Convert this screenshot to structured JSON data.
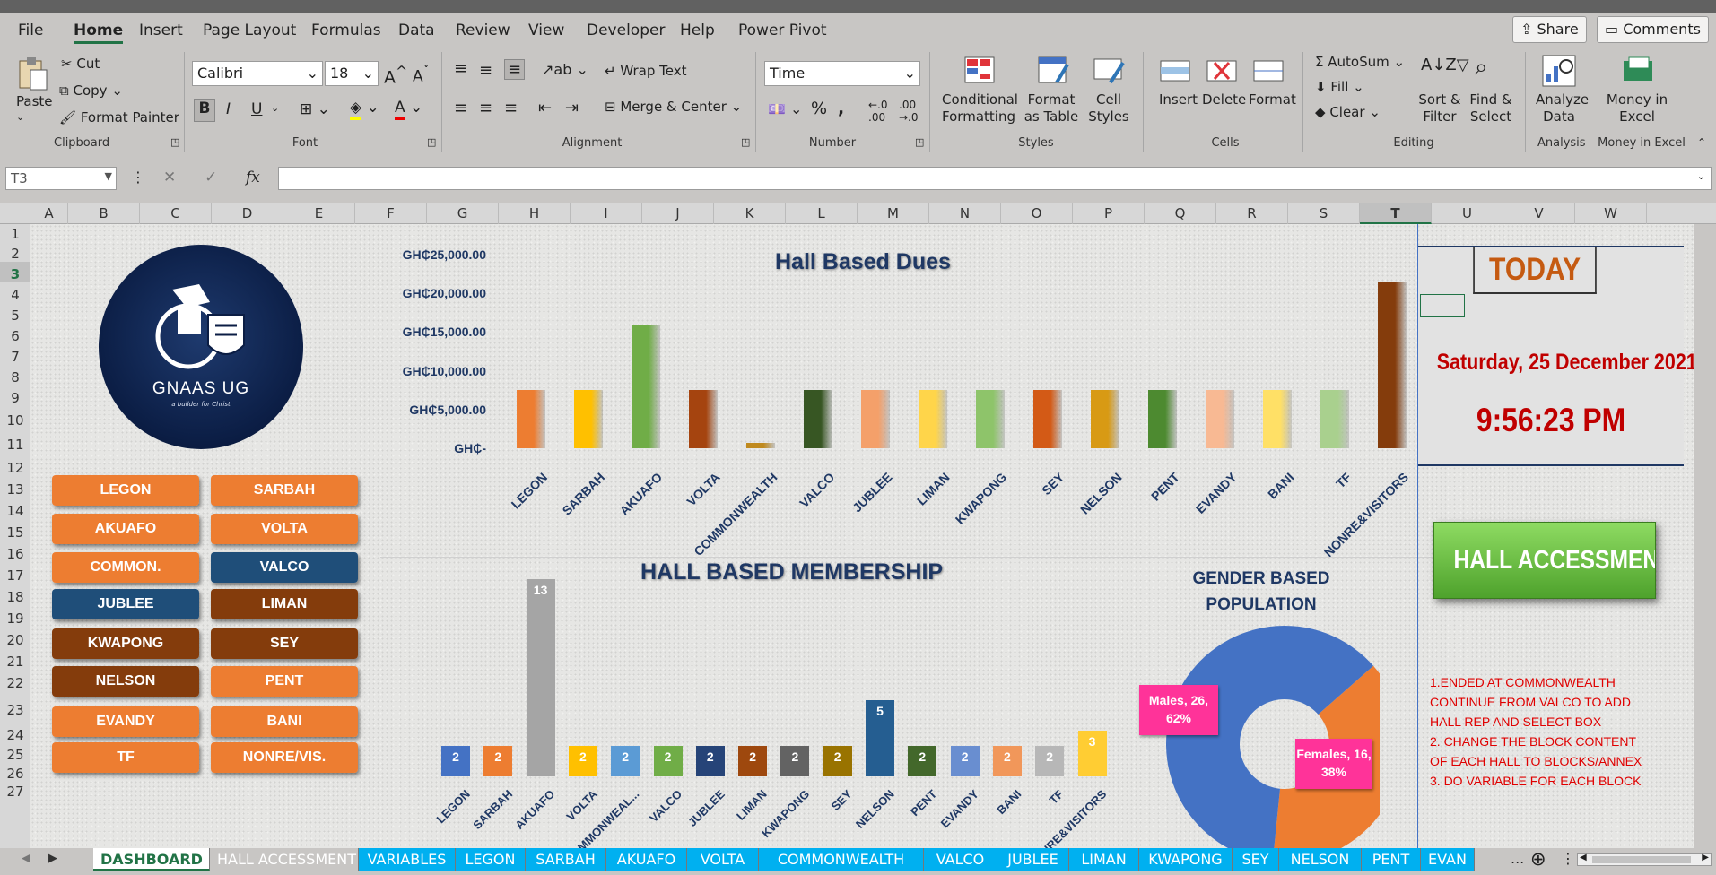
{
  "menu": {
    "items": [
      "File",
      "Home",
      "Insert",
      "Page Layout",
      "Formulas",
      "Data",
      "Review",
      "View",
      "Developer",
      "Help",
      "Power Pivot"
    ],
    "active": "Home",
    "share_label": "Share",
    "comments_label": "Comments"
  },
  "ribbon": {
    "clipboard": {
      "paste": "Paste",
      "cut": "Cut",
      "copy": "Copy",
      "format_painter": "Format Painter",
      "group": "Clipboard"
    },
    "font": {
      "name": "Calibri",
      "size": "18",
      "bold": "B",
      "italic": "I",
      "underline": "U",
      "group": "Font"
    },
    "alignment": {
      "wrap": "Wrap Text",
      "merge": "Merge & Center",
      "group": "Alignment"
    },
    "number": {
      "format": "Time",
      "group": "Number"
    },
    "styles": {
      "conditional": "Conditional Formatting",
      "format_table": "Format as Table",
      "cell_styles": "Cell Styles",
      "group": "Styles"
    },
    "cells": {
      "insert": "Insert",
      "delete": "Delete",
      "format": "Format",
      "group": "Cells"
    },
    "editing": {
      "autosum": "AutoSum",
      "fill": "Fill",
      "clear": "Clear",
      "sort": "Sort & Filter",
      "find": "Find & Select",
      "group": "Editing"
    },
    "analysis": {
      "analyze": "Analyze Data",
      "group": "Analysis"
    },
    "money": {
      "money": "Money in Excel",
      "group": "Money in Excel"
    }
  },
  "formula_bar": {
    "name_box": "T3",
    "fx": "fx",
    "content": ""
  },
  "columns": [
    "A",
    "B",
    "C",
    "D",
    "E",
    "F",
    "G",
    "H",
    "I",
    "J",
    "K",
    "L",
    "M",
    "N",
    "O",
    "P",
    "Q",
    "R",
    "S",
    "T",
    "U",
    "V",
    "W"
  ],
  "rows": [
    "1",
    "2",
    "3",
    "4",
    "5",
    "6",
    "7",
    "8",
    "9",
    "10",
    "11",
    "12",
    "13",
    "14",
    "15",
    "16",
    "17",
    "18",
    "19",
    "20",
    "21",
    "22",
    "23",
    "24",
    "25",
    "26",
    "27"
  ],
  "logo": {
    "text": "GNAAS UG",
    "tagline": "a builder for Christ"
  },
  "hall_buttons": [
    {
      "label": "LEGON",
      "color": "#ed7d31"
    },
    {
      "label": "SARBAH",
      "color": "#ed7d31"
    },
    {
      "label": "AKUAFO",
      "color": "#ed7d31"
    },
    {
      "label": "VOLTA",
      "color": "#ed7d31"
    },
    {
      "label": "COMMON.",
      "color": "#ed7d31"
    },
    {
      "label": "VALCO",
      "color": "#1f4e79"
    },
    {
      "label": "JUBLEE",
      "color": "#1f4e79"
    },
    {
      "label": "LIMAN",
      "color": "#843c0c"
    },
    {
      "label": "KWAPONG",
      "color": "#843c0c"
    },
    {
      "label": "SEY",
      "color": "#843c0c"
    },
    {
      "label": "NELSON",
      "color": "#843c0c"
    },
    {
      "label": "PENT",
      "color": "#ed7d31"
    },
    {
      "label": "EVANDY",
      "color": "#ed7d31"
    },
    {
      "label": "BANI",
      "color": "#ed7d31"
    },
    {
      "label": "TF",
      "color": "#ed7d31"
    },
    {
      "label": "NONRE/VIS.",
      "color": "#ed7d31"
    }
  ],
  "chart_data": [
    {
      "type": "bar",
      "title": "Hall Based Dues",
      "y_ticks": [
        "GH₵25,000.00",
        "GH₵20,000.00",
        "GH₵15,000.00",
        "GH₵10,000.00",
        "GH₵5,000.00",
        "GH₵-"
      ],
      "ylim": [
        0,
        25000
      ],
      "categories": [
        "LEGON",
        "SARBAH",
        "AKUAFO",
        "VOLTA",
        "COMMONWEALTH",
        "VALCO",
        "JUBLEE",
        "LIMAN",
        "KWAPONG",
        "SEY",
        "NELSON",
        "PENT",
        "EVANDY",
        "BANI",
        "TF",
        "NONRE&VISITORS"
      ],
      "values": [
        7500,
        7500,
        16000,
        7500,
        700,
        7500,
        7500,
        7500,
        7500,
        7500,
        7500,
        7500,
        7500,
        7500,
        7500,
        21500
      ],
      "colors": [
        "#ed7d31",
        "#ffc000",
        "#70ad47",
        "#a5440f",
        "#c08a1e",
        "#375623",
        "#f4a06a",
        "#ffd54a",
        "#8ec46a",
        "#d35a16",
        "#d89a14",
        "#4d8a30",
        "#f8b993",
        "#ffe066",
        "#a9d08e",
        "#843c0c"
      ]
    },
    {
      "type": "bar",
      "title": "HALL BASED MEMBERSHIP",
      "categories": [
        "LEGON",
        "SARBAH",
        "AKUAFO",
        "VOLTA",
        "COMMONWEAL...",
        "VALCO",
        "JUBLEE",
        "LIMAN",
        "KWAPONG",
        "SEY",
        "NELSON",
        "PENT",
        "EVANDY",
        "BANI",
        "TF",
        "NONRE&VISITORS"
      ],
      "values": [
        2,
        2,
        13,
        2,
        2,
        2,
        2,
        2,
        2,
        2,
        5,
        2,
        2,
        2,
        2,
        3
      ],
      "labels": [
        "2",
        "2",
        "13",
        "2",
        "2",
        "2",
        "2",
        "2",
        "2",
        "2",
        "5",
        "2",
        "2",
        "2",
        "2",
        "3"
      ],
      "colors": [
        "#4472c4",
        "#ed7d31",
        "#a5a5a5",
        "#ffc000",
        "#5b9bd5",
        "#70ad47",
        "#264478",
        "#9e480e",
        "#636363",
        "#997300",
        "#255e91",
        "#43682b",
        "#698ed0",
        "#f1975a",
        "#b7b7b7",
        "#ffcd33"
      ]
    },
    {
      "type": "pie",
      "title": "GENDER BASED POPULATION",
      "series": [
        {
          "name": "Males",
          "value": 26,
          "percent": 62,
          "label": "Males, 26, 62%",
          "color": "#4472c4"
        },
        {
          "name": "Females",
          "value": 16,
          "percent": 38,
          "label": "Females, 16, 38%",
          "color": "#ed7d31"
        }
      ]
    }
  ],
  "today_panel": {
    "heading": "TODAY",
    "date": "Saturday, 25 December 2021",
    "time": "9:56:23 PM"
  },
  "hall_accessment_button": "HALL ACCESSMENT",
  "notes": [
    "1.ENDED AT COMMONWEALTH",
    "CONTINUE FROM VALCO TO ADD",
    "HALL REP AND SELECT BOX",
    "2. CHANGE THE BLOCK CONTENT",
    "OF EACH HALL TO BLOCKS/ANNEX",
    "3. DO VARIABLE FOR EACH BLOCK"
  ],
  "sheet_tabs": [
    {
      "label": "DASHBOARD",
      "active": true
    },
    {
      "label": "HALL ACCESSMENT"
    },
    {
      "label": "VARIABLES"
    },
    {
      "label": "LEGON"
    },
    {
      "label": "SARBAH"
    },
    {
      "label": "AKUAFO"
    },
    {
      "label": "VOLTA"
    },
    {
      "label": "COMMONWEALTH"
    },
    {
      "label": "VALCO"
    },
    {
      "label": "JUBLEE"
    },
    {
      "label": "LIMAN"
    },
    {
      "label": "KWAPONG"
    },
    {
      "label": "SEY"
    },
    {
      "label": "NELSON"
    },
    {
      "label": "PENT"
    },
    {
      "label": "EVAN"
    }
  ],
  "tab_overflow": "..."
}
